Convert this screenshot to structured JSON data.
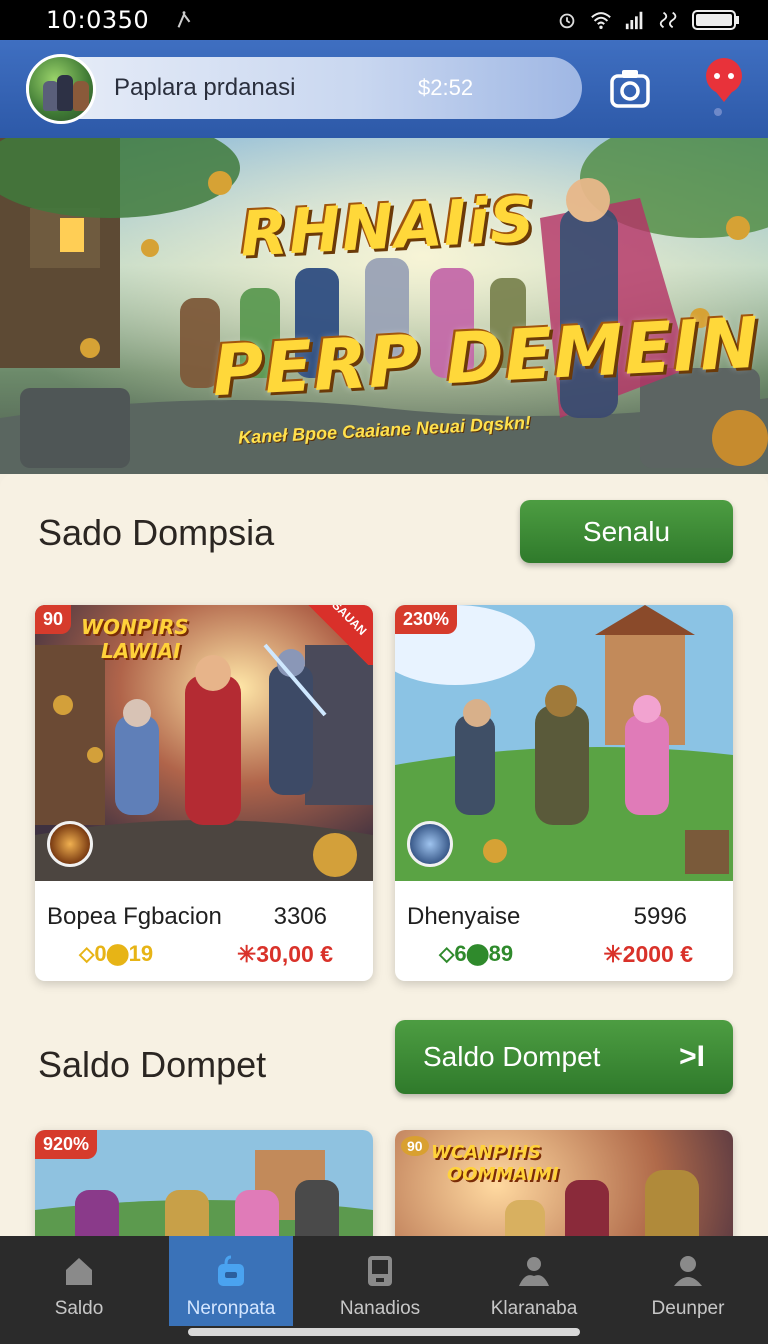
{
  "status_bar": {
    "time": "10:0350"
  },
  "header": {
    "search_text": "Paplara prdanasi",
    "balance": "$2:52",
    "camera_icon": "camera-icon",
    "notification_icon": "notification-icon"
  },
  "banner": {
    "title_line1": "RHNAIiS",
    "title_line2": "PERP DEMEIN",
    "tagline": "Kaneł Bpoe Caaiane Neuai Dqskn!"
  },
  "section1": {
    "title": "Sado Dompsia",
    "button_label": "Senalu"
  },
  "cards_row1": [
    {
      "art_title_line1": "WONPIRS",
      "art_title_line2": "LAWIAI",
      "ribbon": "90",
      "corner_label": "SAUAN",
      "name": "Bopea Fgbacion",
      "number": "3306",
      "rating": "⬦0⬤19",
      "price": "✳30,00 €"
    },
    {
      "ribbon": "230%",
      "name": "Dhenyaise",
      "number": "5996",
      "rating": "⬦6⬤89",
      "price": "✳2000 €"
    }
  ],
  "section2": {
    "title": "Saldo Dompet",
    "button_label": "Saldo Dompet",
    "button_arrow": ">I"
  },
  "cards_row2": [
    {
      "ribbon": "920%"
    },
    {
      "art_title_line1": "WCANPIHS",
      "art_title_line2": "OOMMAIMI",
      "ribbon": "90"
    }
  ],
  "bottom_nav": [
    {
      "label": "Saldo",
      "icon": "home-icon"
    },
    {
      "label": "Neronpata",
      "icon": "bag-icon",
      "active": true
    },
    {
      "label": "Nanadios",
      "icon": "tablet-icon"
    },
    {
      "label": "Klaranaba",
      "icon": "group-icon"
    },
    {
      "label": "Deunper",
      "icon": "profile-icon"
    }
  ],
  "colors": {
    "header_blue": "#2d59a8",
    "button_green": "#2f7a2b",
    "price_red": "#d9322a",
    "rating_gold": "#e7b416",
    "nav_active": "#3a72b8"
  }
}
